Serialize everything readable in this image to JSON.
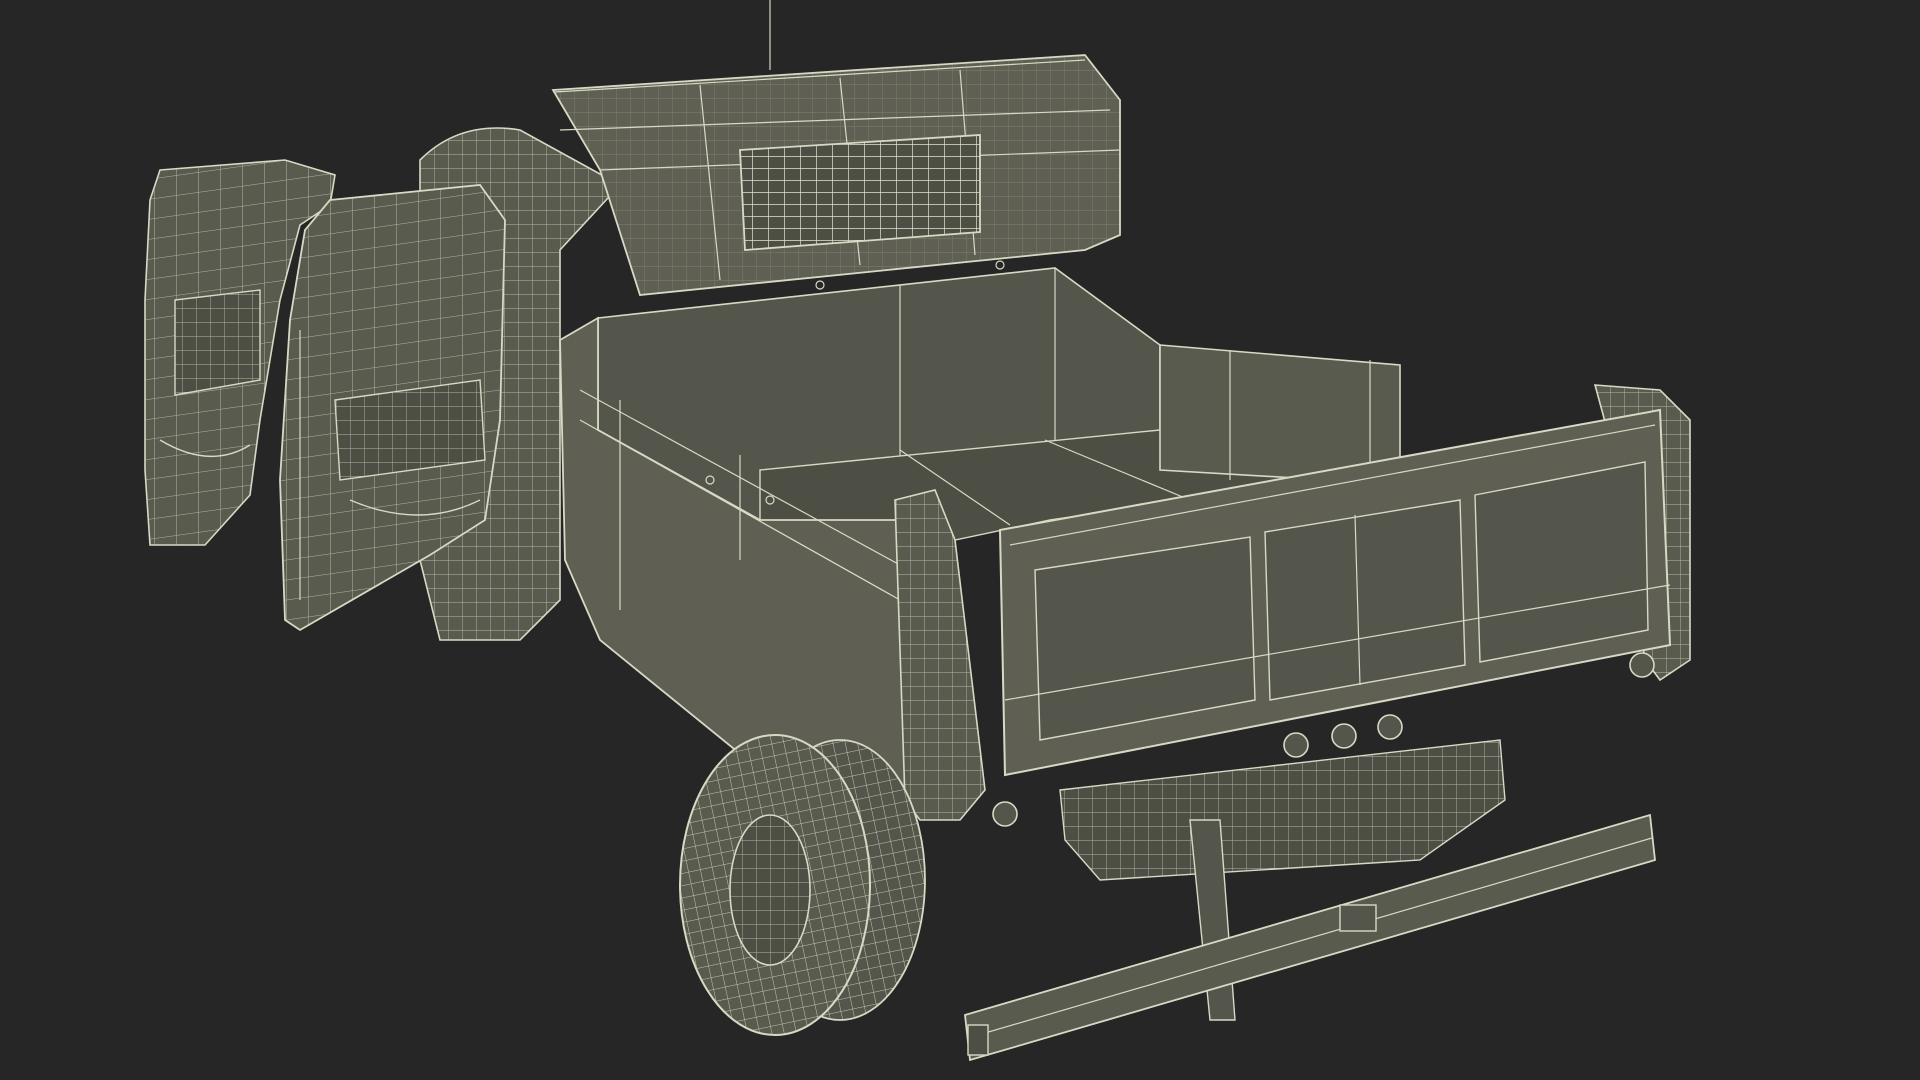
{
  "scene": {
    "background_color": "#262626",
    "fill_color": "#5a5b4f",
    "fill_dark_color": "#4d4e44",
    "fill_light_color": "#67685b",
    "wire_color": "#d8d9c4",
    "subject": "dump-truck-wireframe",
    "render_mode": "wireframe-on-shaded"
  }
}
